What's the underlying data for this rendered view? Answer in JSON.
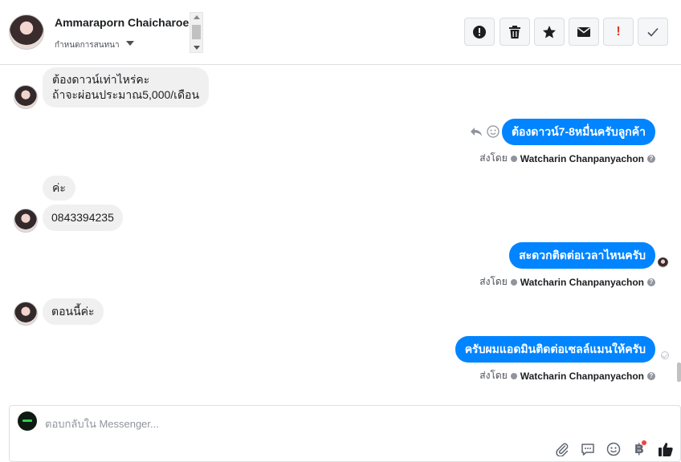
{
  "header": {
    "contact_name": "Ammaraporn Chaicharoen",
    "conversation_status": "กำหนดการสนทนา",
    "tools": [
      {
        "name": "mark-spam-icon",
        "label": "!"
      },
      {
        "name": "trash-icon",
        "label": ""
      },
      {
        "name": "star-icon",
        "label": ""
      },
      {
        "name": "envelope-icon",
        "label": ""
      },
      {
        "name": "important-icon",
        "label": "!"
      },
      {
        "name": "check-icon",
        "label": ""
      }
    ]
  },
  "messages": [
    {
      "from": "customer",
      "lines": [
        "ต้องดาวน์เท่าไหร่คะ",
        "ถ้าจะผ่อนประมาณ5,000/เดือน"
      ]
    },
    {
      "from": "page",
      "text": "ต้องดาวน์7-8หมื่นครับลูกค้า",
      "sent_by_label": "ส่งโดย",
      "agent": "Watcharin Chanpanyachon"
    },
    {
      "from": "customer",
      "text": "ค่ะ"
    },
    {
      "from": "customer",
      "text": "0843394235"
    },
    {
      "from": "page",
      "text": "สะดวกติดต่อเวลาไหนครับ",
      "sent_by_label": "ส่งโดย",
      "agent": "Watcharin Chanpanyachon"
    },
    {
      "from": "customer",
      "text": "ตอนนี้ค่ะ"
    },
    {
      "from": "page",
      "text": "ครับผมแอดมินติดต่อเซลล์แมนให้ครับ",
      "sent_by_label": "ส่งโดย",
      "agent": "Watcharin Chanpanyachon"
    }
  ],
  "composer": {
    "placeholder": "ตอบกลับใน Messenger...",
    "value": "",
    "icons": [
      "paperclip-icon",
      "saved-replies-icon",
      "emoji-icon",
      "baht-payment-icon",
      "like-icon"
    ]
  },
  "colors": {
    "outgoing_bubble": "#0084ff",
    "incoming_bubble": "#f1f0f0",
    "notification_dot": "#fa3e3e",
    "important_red": "#e0392b"
  }
}
